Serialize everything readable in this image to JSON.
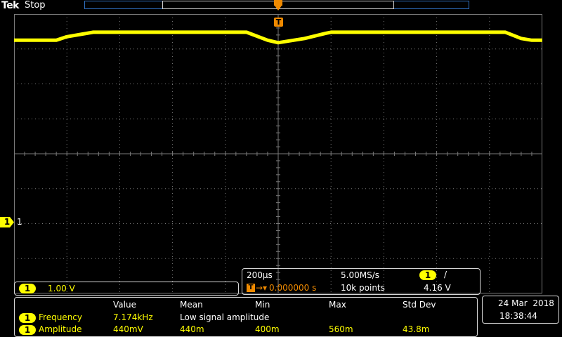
{
  "header": {
    "brand": "Tek",
    "acquisition_state": "Stop",
    "trigger_position_marker": "T"
  },
  "channel_marker": {
    "badge": "1",
    "label": "1"
  },
  "channel_box": {
    "channel": "1",
    "scale": "1.00 V"
  },
  "horizontal": {
    "time_per_div": "200µs",
    "sample_rate": "5.00MS/s",
    "trigger_channel": "1",
    "trigger_slope": "/",
    "trigger_badge": "T",
    "trigger_arrow": "→▾",
    "position": "0.000000 s",
    "record_length": "10k points",
    "trigger_level": "4.16 V"
  },
  "measurements": {
    "headers": [
      "Value",
      "Mean",
      "Min",
      "Max",
      "Std Dev"
    ],
    "rows": [
      {
        "channel": "1",
        "name": "Frequency",
        "value": "7.174kHz",
        "mean": "Low signal amplitude",
        "min": "",
        "max": "",
        "std": ""
      },
      {
        "channel": "1",
        "name": "Amplitude",
        "value": "440mV",
        "mean": "440m",
        "min": "400m",
        "max": "560m",
        "std": "43.8m"
      }
    ]
  },
  "datetime": {
    "date": "24 Mar  2018",
    "time": "18:38:44"
  },
  "colors": {
    "ch1": "#ffff00",
    "trigger": "#f08a00",
    "record_bar": "#2f6fbf",
    "grid": "#7a7a7a"
  },
  "waveform": {
    "channel": "1",
    "description_units": "divisions above screen center",
    "points": [
      [
        0.0,
        3.25
      ],
      [
        0.8,
        3.25
      ],
      [
        1.0,
        3.35
      ],
      [
        1.5,
        3.48
      ],
      [
        3.0,
        3.48
      ],
      [
        4.4,
        3.48
      ],
      [
        4.8,
        3.25
      ],
      [
        5.0,
        3.18
      ],
      [
        5.5,
        3.3
      ],
      [
        5.9,
        3.45
      ],
      [
        6.0,
        3.48
      ],
      [
        9.0,
        3.48
      ],
      [
        9.3,
        3.48
      ],
      [
        9.6,
        3.3
      ],
      [
        9.8,
        3.25
      ],
      [
        10.0,
        3.25
      ]
    ]
  }
}
